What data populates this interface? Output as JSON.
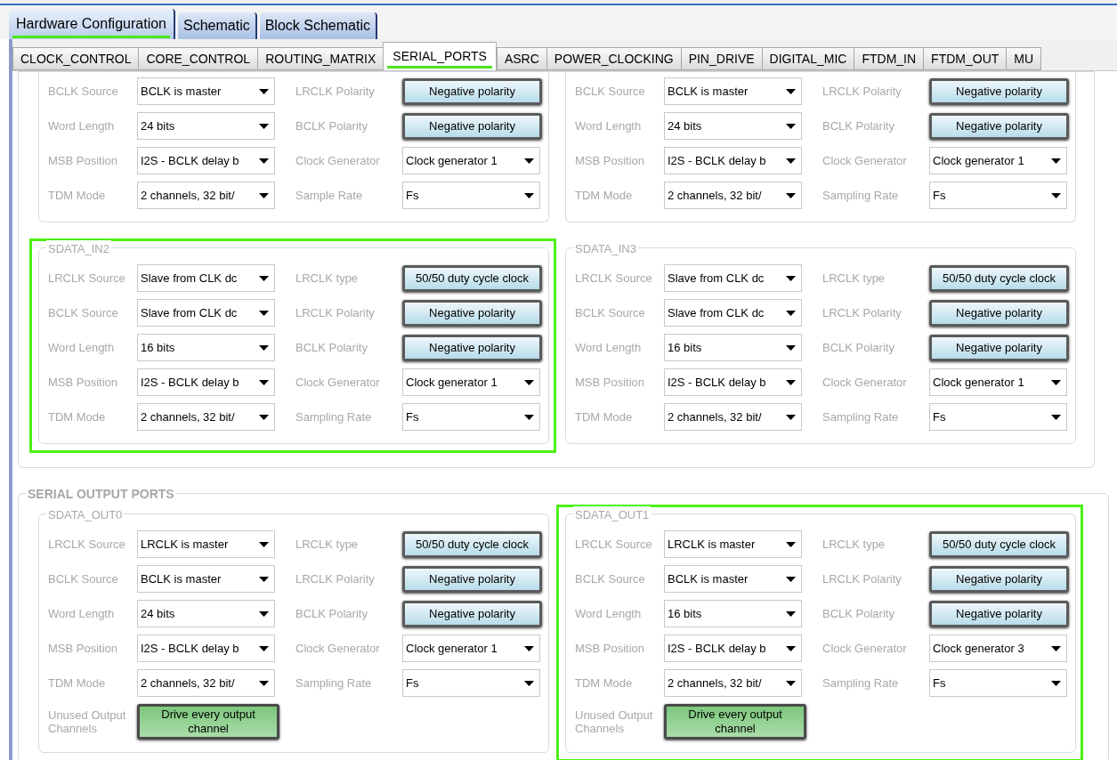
{
  "main_tabs": [
    {
      "label": "Hardware Configuration",
      "selected": true,
      "highlighted": true
    },
    {
      "label": "Schematic",
      "selected": false,
      "highlighted": false
    },
    {
      "label": "Block Schematic",
      "selected": false,
      "highlighted": false
    }
  ],
  "sub_tabs": [
    {
      "label": "CLOCK_CONTROL",
      "selected": false,
      "highlighted": false
    },
    {
      "label": "CORE_CONTROL",
      "selected": false,
      "highlighted": false
    },
    {
      "label": "ROUTING_MATRIX",
      "selected": false,
      "highlighted": false
    },
    {
      "label": "SERIAL_PORTS",
      "selected": true,
      "highlighted": true
    },
    {
      "label": "ASRC",
      "selected": false,
      "highlighted": false
    },
    {
      "label": "POWER_CLOCKING",
      "selected": false,
      "highlighted": false
    },
    {
      "label": "PIN_DRIVE",
      "selected": false,
      "highlighted": false
    },
    {
      "label": "DIGITAL_MIC",
      "selected": false,
      "highlighted": false
    },
    {
      "label": "FTDM_IN",
      "selected": false,
      "highlighted": false
    },
    {
      "label": "FTDM_OUT",
      "selected": false,
      "highlighted": false
    },
    {
      "label": "MU",
      "selected": false,
      "highlighted": false
    }
  ],
  "input_ports": {
    "groups": [
      {
        "highlighted": false,
        "fields": [
          {
            "label": "BCLK Source",
            "kind": "dropdown",
            "value": "BCLK is master"
          },
          {
            "label": "LRCLK Polarity",
            "kind": "toggle",
            "value": "Negative polarity"
          },
          {
            "label": "Word Length",
            "kind": "dropdown",
            "value": "24 bits"
          },
          {
            "label": "BCLK Polarity",
            "kind": "toggle",
            "value": "Negative polarity"
          },
          {
            "label": "MSB Position",
            "kind": "dropdown",
            "value": "I2S - BCLK delay b"
          },
          {
            "label": "Clock Generator",
            "kind": "dropdown",
            "value": "Clock generator 1"
          },
          {
            "label": "TDM Mode",
            "kind": "dropdown",
            "value": "2 channels, 32 bit/"
          },
          {
            "label": "Sample Rate",
            "kind": "dropdown",
            "value": "Fs"
          }
        ]
      },
      {
        "highlighted": false,
        "fields": [
          {
            "label": "BCLK Source",
            "kind": "dropdown",
            "value": "BCLK is master"
          },
          {
            "label": "LRCLK Polarity",
            "kind": "toggle",
            "value": "Negative polarity"
          },
          {
            "label": "Word Length",
            "kind": "dropdown",
            "value": "24 bits"
          },
          {
            "label": "BCLK Polarity",
            "kind": "toggle",
            "value": "Negative polarity"
          },
          {
            "label": "MSB Position",
            "kind": "dropdown",
            "value": "I2S - BCLK delay b"
          },
          {
            "label": "Clock Generator",
            "kind": "dropdown",
            "value": "Clock generator 1"
          },
          {
            "label": "TDM Mode",
            "kind": "dropdown",
            "value": "2 channels, 32 bit/"
          },
          {
            "label": "Sampling Rate",
            "kind": "dropdown",
            "value": "Fs"
          }
        ]
      },
      {
        "title": "SDATA_IN2",
        "highlighted": true,
        "fields": [
          {
            "label": "LRCLK Source",
            "kind": "dropdown",
            "value": "Slave from CLK dc"
          },
          {
            "label": "LRCLK type",
            "kind": "toggle",
            "value": "50/50 duty cycle clock"
          },
          {
            "label": "BCLK Source",
            "kind": "dropdown",
            "value": "Slave from CLK dc"
          },
          {
            "label": "LRCLK Polarity",
            "kind": "toggle",
            "value": "Negative polarity"
          },
          {
            "label": "Word Length",
            "kind": "dropdown",
            "value": "16 bits"
          },
          {
            "label": "BCLK Polarity",
            "kind": "toggle",
            "value": "Negative polarity"
          },
          {
            "label": "MSB Position",
            "kind": "dropdown",
            "value": "I2S - BCLK delay b"
          },
          {
            "label": "Clock Generator",
            "kind": "dropdown",
            "value": "Clock generator 1"
          },
          {
            "label": "TDM Mode",
            "kind": "dropdown",
            "value": "2 channels, 32 bit/"
          },
          {
            "label": "Sampling Rate",
            "kind": "dropdown",
            "value": "Fs"
          }
        ]
      },
      {
        "title": "SDATA_IN3",
        "highlighted": false,
        "fields": [
          {
            "label": "LRCLK Source",
            "kind": "dropdown",
            "value": "Slave from CLK dc"
          },
          {
            "label": "LRCLK type",
            "kind": "toggle",
            "value": "50/50 duty cycle clock"
          },
          {
            "label": "BCLK Source",
            "kind": "dropdown",
            "value": "Slave from CLK dc"
          },
          {
            "label": "LRCLK Polarity",
            "kind": "toggle",
            "value": "Negative polarity"
          },
          {
            "label": "Word Length",
            "kind": "dropdown",
            "value": "16 bits"
          },
          {
            "label": "BCLK Polarity",
            "kind": "toggle",
            "value": "Negative polarity"
          },
          {
            "label": "MSB Position",
            "kind": "dropdown",
            "value": "I2S - BCLK delay b"
          },
          {
            "label": "Clock Generator",
            "kind": "dropdown",
            "value": "Clock generator 1"
          },
          {
            "label": "TDM Mode",
            "kind": "dropdown",
            "value": "2 channels, 32 bit/"
          },
          {
            "label": "Sampling Rate",
            "kind": "dropdown",
            "value": "Fs"
          }
        ]
      }
    ]
  },
  "output_ports": {
    "title": "SERIAL OUTPUT PORTS",
    "groups": [
      {
        "title": "SDATA_OUT0",
        "highlighted": false,
        "fields": [
          {
            "label": "LRCLK Source",
            "kind": "dropdown",
            "value": "LRCLK is master"
          },
          {
            "label": "LRCLK type",
            "kind": "toggle",
            "value": "50/50 duty cycle clock"
          },
          {
            "label": "BCLK Source",
            "kind": "dropdown",
            "value": "BCLK is master"
          },
          {
            "label": "LRCLK Polarity",
            "kind": "toggle",
            "value": "Negative polarity"
          },
          {
            "label": "Word Length",
            "kind": "dropdown",
            "value": "24 bits"
          },
          {
            "label": "BCLK Polarity",
            "kind": "toggle",
            "value": "Negative polarity"
          },
          {
            "label": "MSB Position",
            "kind": "dropdown",
            "value": "I2S - BCLK delay b"
          },
          {
            "label": "Clock Generator",
            "kind": "dropdown",
            "value": "Clock generator 1"
          },
          {
            "label": "TDM Mode",
            "kind": "dropdown",
            "value": "2 channels, 32 bit/"
          },
          {
            "label": "Sampling Rate",
            "kind": "dropdown",
            "value": "Fs"
          },
          {
            "label": "Unused Output Channels",
            "kind": "drive",
            "value": "Drive every output channel"
          }
        ]
      },
      {
        "title": "SDATA_OUT1",
        "highlighted": true,
        "fields": [
          {
            "label": "LRCLK Source",
            "kind": "dropdown",
            "value": "LRCLK is master"
          },
          {
            "label": "LRCLK type",
            "kind": "toggle",
            "value": "50/50 duty cycle clock"
          },
          {
            "label": "BCLK Source",
            "kind": "dropdown",
            "value": "BCLK is master"
          },
          {
            "label": "LRCLK Polarity",
            "kind": "toggle",
            "value": "Negative polarity"
          },
          {
            "label": "Word Length",
            "kind": "dropdown",
            "value": "16 bits"
          },
          {
            "label": "BCLK Polarity",
            "kind": "toggle",
            "value": "Negative polarity"
          },
          {
            "label": "MSB Position",
            "kind": "dropdown",
            "value": "I2S - BCLK delay b"
          },
          {
            "label": "Clock Generator",
            "kind": "dropdown",
            "value": "Clock generator 3"
          },
          {
            "label": "TDM Mode",
            "kind": "dropdown",
            "value": "2 channels, 32 bit/"
          },
          {
            "label": "Sampling Rate",
            "kind": "dropdown",
            "value": "Fs"
          },
          {
            "label": "Unused Output Channels",
            "kind": "drive",
            "value": "Drive every output channel"
          }
        ]
      }
    ]
  }
}
